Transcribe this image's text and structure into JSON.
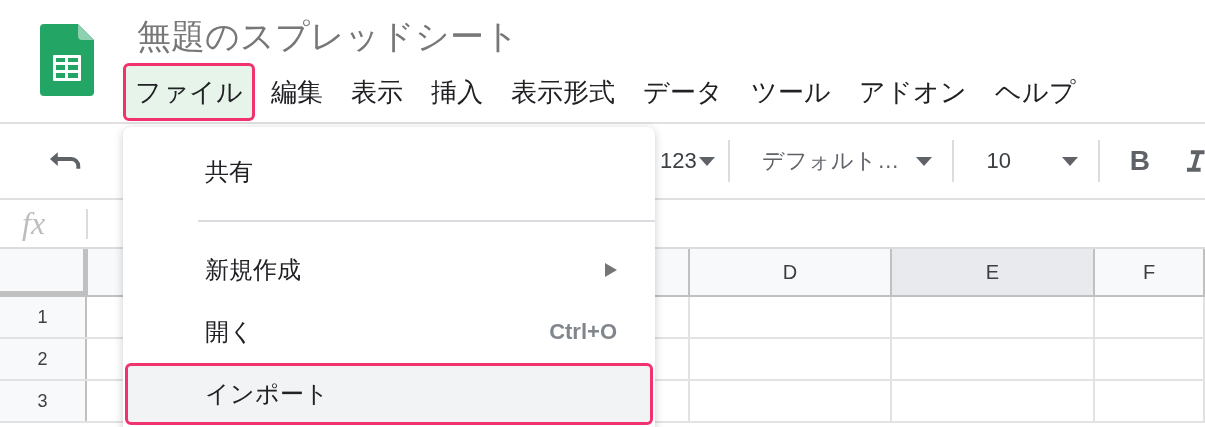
{
  "document": {
    "title": "無題のスプレッドシート"
  },
  "menubar": [
    {
      "label": "ファイル",
      "selected": true,
      "highlighted": true
    },
    {
      "label": "編集",
      "selected": false,
      "highlighted": false
    },
    {
      "label": "表示",
      "selected": false,
      "highlighted": false
    },
    {
      "label": "挿入",
      "selected": false,
      "highlighted": false
    },
    {
      "label": "表示形式",
      "selected": false,
      "highlighted": false
    },
    {
      "label": "データ",
      "selected": false,
      "highlighted": false
    },
    {
      "label": "ツール",
      "selected": false,
      "highlighted": false
    },
    {
      "label": "アドオン",
      "selected": false,
      "highlighted": false
    },
    {
      "label": "ヘルプ",
      "selected": false,
      "highlighted": false
    }
  ],
  "toolbar": {
    "number_format": "123",
    "font": "デフォルト…",
    "font_size": "10",
    "bold": "B"
  },
  "formula_bar": {
    "label": "fx"
  },
  "columns": [
    {
      "label": "D",
      "selected": false
    },
    {
      "label": "E",
      "selected": true
    },
    {
      "label": "F",
      "selected": false
    }
  ],
  "rows": [
    "1",
    "2",
    "3"
  ],
  "file_menu": [
    {
      "kind": "item",
      "label": "共有",
      "hovered": false,
      "highlighted": false
    },
    {
      "kind": "divider"
    },
    {
      "kind": "submenu",
      "label": "新規作成",
      "hovered": false,
      "highlighted": false
    },
    {
      "kind": "item",
      "label": "開く",
      "shortcut": "Ctrl+O",
      "hovered": false,
      "highlighted": false
    },
    {
      "kind": "item",
      "label": "インポート",
      "hovered": true,
      "highlighted": true
    }
  ]
}
